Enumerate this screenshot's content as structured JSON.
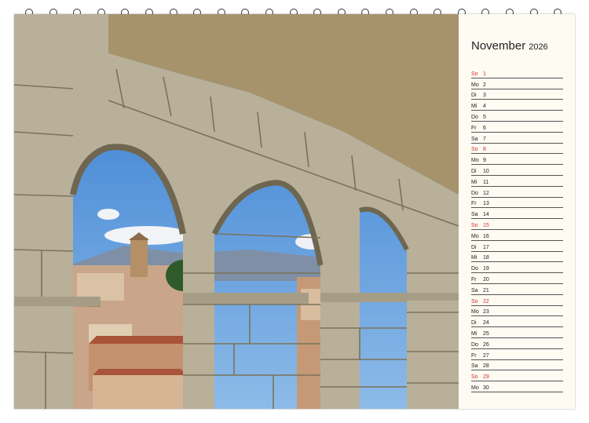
{
  "calendar": {
    "month": "November",
    "year": "2026",
    "days": [
      {
        "dn": "So",
        "num": "1",
        "sunday": true
      },
      {
        "dn": "Mo",
        "num": "2"
      },
      {
        "dn": "Di",
        "num": "3"
      },
      {
        "dn": "Mi",
        "num": "4"
      },
      {
        "dn": "Do",
        "num": "5"
      },
      {
        "dn": "Fr",
        "num": "6"
      },
      {
        "dn": "Sa",
        "num": "7"
      },
      {
        "dn": "So",
        "num": "8",
        "sunday": true
      },
      {
        "dn": "Mo",
        "num": "9"
      },
      {
        "dn": "Di",
        "num": "10"
      },
      {
        "dn": "Mi",
        "num": "11"
      },
      {
        "dn": "Do",
        "num": "12"
      },
      {
        "dn": "Fr",
        "num": "13"
      },
      {
        "dn": "Sa",
        "num": "14"
      },
      {
        "dn": "So",
        "num": "15",
        "sunday": true
      },
      {
        "dn": "Mo",
        "num": "16"
      },
      {
        "dn": "Di",
        "num": "17"
      },
      {
        "dn": "Mi",
        "num": "18"
      },
      {
        "dn": "Do",
        "num": "19"
      },
      {
        "dn": "Fr",
        "num": "20"
      },
      {
        "dn": "Sa",
        "num": "21"
      },
      {
        "dn": "So",
        "num": "22",
        "sunday": true
      },
      {
        "dn": "Mo",
        "num": "23"
      },
      {
        "dn": "Di",
        "num": "24"
      },
      {
        "dn": "Mi",
        "num": "25"
      },
      {
        "dn": "Do",
        "num": "26"
      },
      {
        "dn": "Fr",
        "num": "27"
      },
      {
        "dn": "Sa",
        "num": "28"
      },
      {
        "dn": "So",
        "num": "29",
        "sunday": true
      },
      {
        "dn": "Mo",
        "num": "30"
      }
    ]
  },
  "colors": {
    "sunday": "#d0312d",
    "paper": "#fdfbf2",
    "stone": "#b9b09a",
    "sky": "#4a8fd6"
  }
}
